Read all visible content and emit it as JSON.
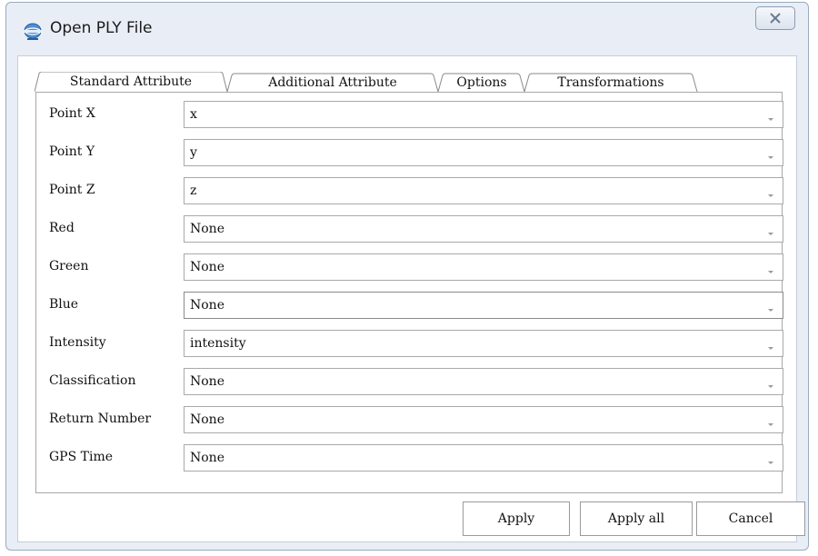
{
  "window": {
    "title": "Open PLY File",
    "app_icon": "globe-app-icon",
    "close_icon": "close-icon"
  },
  "tabs": [
    {
      "label": "Standard Attribute",
      "active": true
    },
    {
      "label": "Additional Attribute",
      "active": false
    },
    {
      "label": "Options",
      "active": false
    },
    {
      "label": "Transformations",
      "active": false
    }
  ],
  "fields": [
    {
      "label": "Point X",
      "value": "x"
    },
    {
      "label": "Point Y",
      "value": "y"
    },
    {
      "label": "Point Z",
      "value": "z"
    },
    {
      "label": "Red",
      "value": "None"
    },
    {
      "label": "Green",
      "value": "None"
    },
    {
      "label": "Blue",
      "value": "None"
    },
    {
      "label": "Intensity",
      "value": "intensity"
    },
    {
      "label": "Classification",
      "value": "None"
    },
    {
      "label": "Return Number",
      "value": "None"
    },
    {
      "label": "GPS Time",
      "value": "None"
    }
  ],
  "buttons": {
    "apply": "Apply",
    "apply_all": "Apply all",
    "cancel": "Cancel"
  }
}
